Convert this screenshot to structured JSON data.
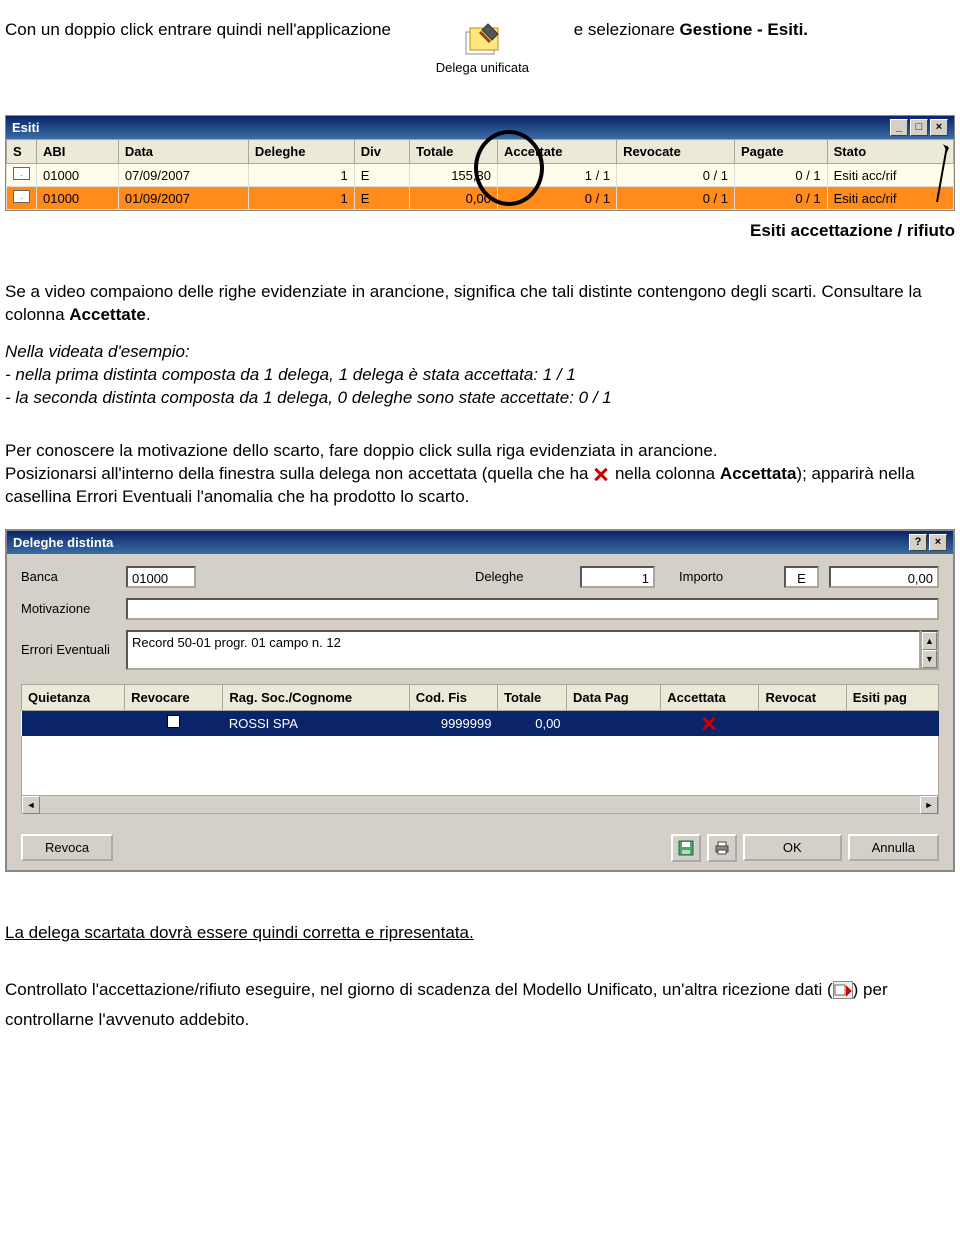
{
  "intro": {
    "pre": "Con un doppio click entrare quindi nell'applicazione",
    "icon_label": "Delega unificata",
    "post_pre": "e selezionare ",
    "post_bold": "Gestione - Esiti."
  },
  "esiti_window": {
    "title": "Esiti",
    "columns": [
      "S",
      "ABI",
      "Data",
      "Deleghe",
      "Div",
      "Totale",
      "Accettate",
      "Revocate",
      "Pagate",
      "Stato"
    ],
    "rows": [
      {
        "abi": "01000",
        "data": "07/09/2007",
        "deleghe": "1",
        "div": "E",
        "totale": "155,30",
        "accettate": "1 / 1",
        "revocate": "0 / 1",
        "pagate": "0 / 1",
        "stato": "Esiti acc/rif"
      },
      {
        "abi": "01000",
        "data": "01/09/2007",
        "deleghe": "1",
        "div": "E",
        "totale": "0,00",
        "accettate": "0 / 1",
        "revocate": "0 / 1",
        "pagate": "0 / 1",
        "stato": "Esiti acc/rif"
      }
    ]
  },
  "caption_right": "Esiti accettazione / rifiuto",
  "para1_pre": "Se a video compaiono delle righe evidenziate in arancione, significa che tali distinte contengono degli scarti. Consultare la colonna ",
  "para1_bold": "Accettate",
  "para1_post": ".",
  "para2_l1": "Nella videata d'esempio:",
  "para2_l2": "- nella prima distinta composta da 1 delega, 1 delega è stata accettata: 1 / 1",
  "para2_l3": "- la seconda distinta composta da 1 delega, 0 deleghe sono state accettate: 0 / 1",
  "para3_l1": "Per conoscere la motivazione dello scarto, fare doppio click sulla riga evidenziata in arancione.",
  "para3_l2_pre": "Posizionarsi all'interno della finestra sulla delega non accettata (quella che ha ",
  "para3_l2_post_pre": " nella colonna ",
  "para3_l2_bold": "Accettata",
  "para3_l2_post": "); apparirà nella casellina Errori Eventuali l'anomalia che ha prodotto lo scarto.",
  "dlg": {
    "title": "Deleghe distinta",
    "lbl_banca": "Banca",
    "val_banca": "01000",
    "lbl_deleghe": "Deleghe",
    "val_deleghe": "1",
    "lbl_importo": "Importo",
    "val_importo_curr": "E",
    "val_importo": "0,00",
    "lbl_motivazione": "Motivazione",
    "val_motivazione": "",
    "lbl_errori": "Errori Eventuali",
    "val_errori": "Record 50-01 progr. 01 campo n. 12",
    "columns": [
      "Quietanza",
      "Revocare",
      "Rag. Soc./Cognome",
      "Cod. Fis",
      "Totale",
      "Data Pag",
      "Accettata",
      "Revocat",
      "Esiti pag"
    ],
    "row": {
      "quietanza": "",
      "revocare": "",
      "rag": "ROSSI SPA",
      "cf": "9999999",
      "totale": "0,00",
      "datapag": "",
      "accettata": "X",
      "revocata": "",
      "esiti": ""
    },
    "btn_revoca": "Revoca",
    "btn_ok": "OK",
    "btn_annulla": "Annulla"
  },
  "footer1": "La delega scartata dovrà essere quindi corretta e ripresentata.",
  "footer2_pre": "Controllato l'accettazione/rifiuto eseguire, nel giorno di scadenza del Modello Unificato, un'altra ricezione dati  (",
  "footer2_post": ") per controllarne l'avvenuto addebito."
}
